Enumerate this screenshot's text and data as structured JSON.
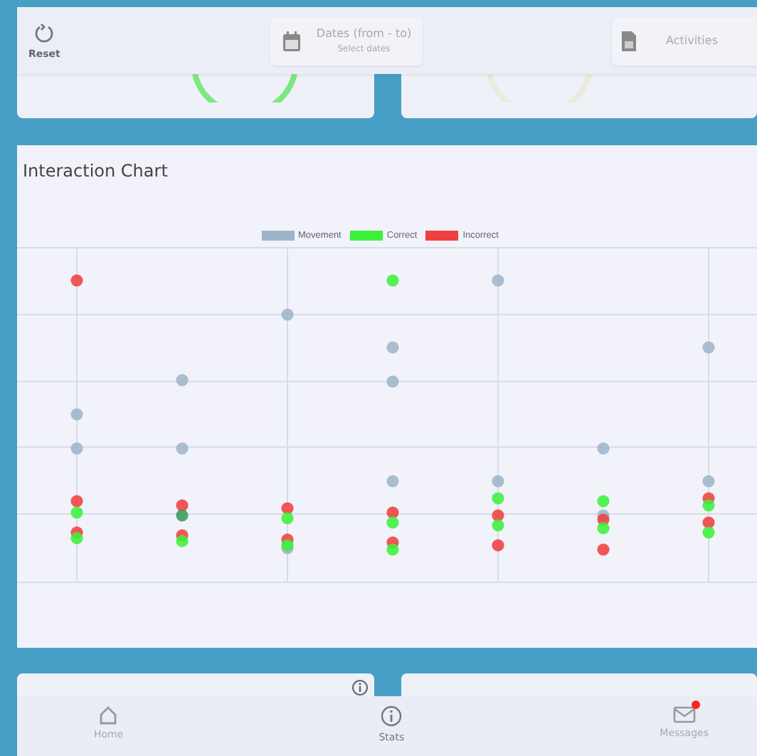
{
  "toolbar": {
    "reset": {
      "label": "Reset"
    },
    "dates": {
      "label": "Dates (from - to)",
      "placeholder": "Select dates"
    },
    "activities": {
      "label": "Activities"
    }
  },
  "interaction_chart": {
    "title": "Interaction Chart",
    "legend": [
      {
        "label": "Movement",
        "color": "#9db5c9"
      },
      {
        "label": "Correct",
        "color": "#3ef03e"
      },
      {
        "label": "Incorrect",
        "color": "#f04040"
      }
    ]
  },
  "bottom_nav": [
    {
      "label": "Home",
      "badge": false
    },
    {
      "label": "Stats",
      "badge": false
    },
    {
      "label": "Messages",
      "badge": true
    }
  ]
}
